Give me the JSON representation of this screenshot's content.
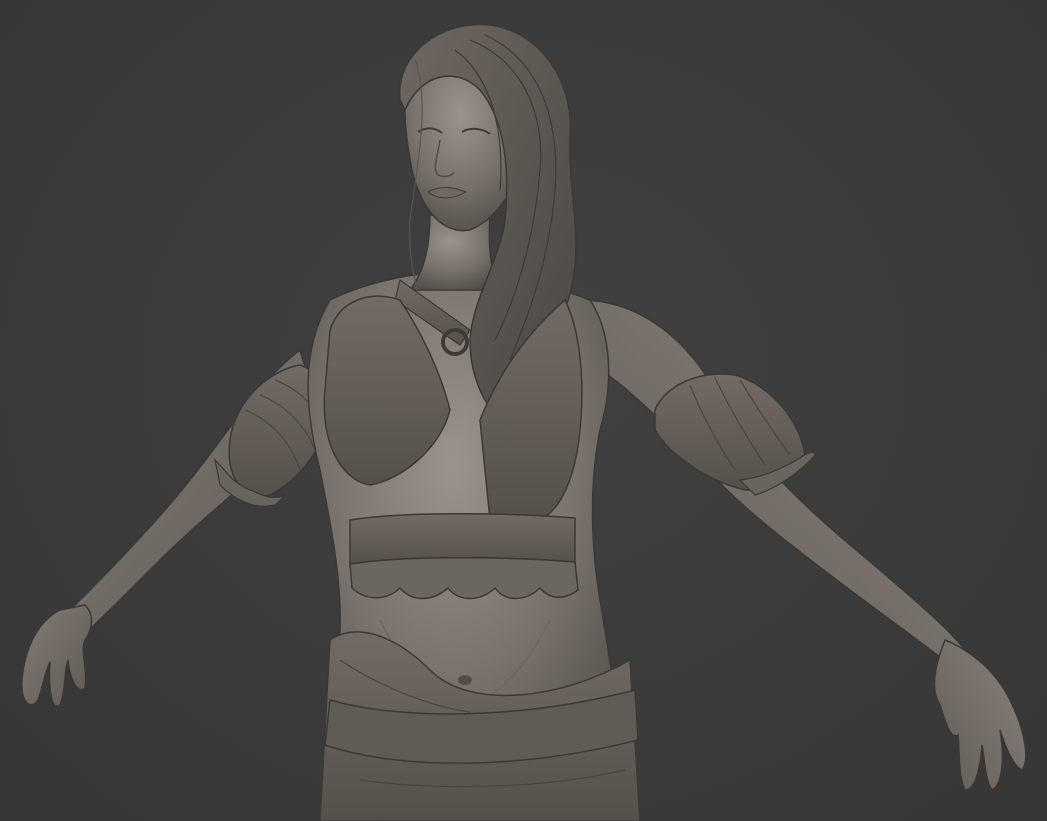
{
  "viewport": {
    "background_color": "#3a3a3a",
    "model_color": "#7d7670",
    "subject": "clay-render-female-character"
  }
}
